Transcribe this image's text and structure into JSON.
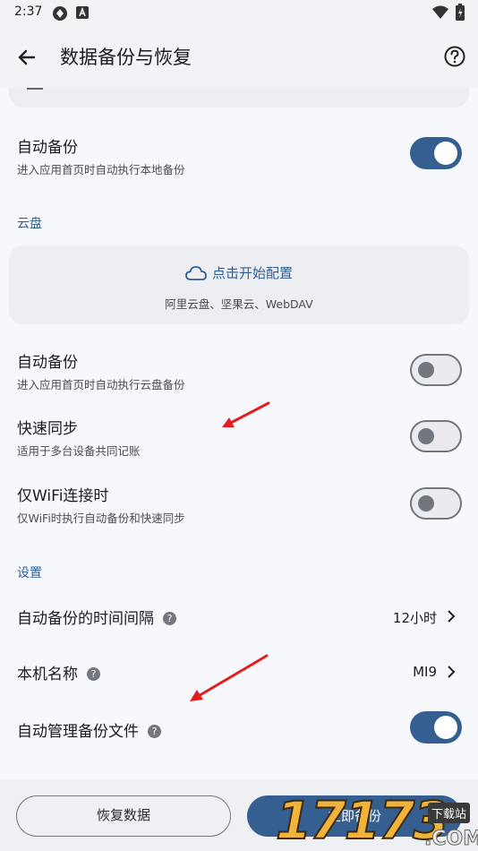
{
  "status_bar": {
    "time": "2:37"
  },
  "app_bar": {
    "title": "数据备份与恢复"
  },
  "local": {
    "auto_backup": {
      "title": "自动备份",
      "subtitle": "进入应用首页时自动执行本地备份",
      "enabled": true
    }
  },
  "cloud": {
    "section_label": "云盘",
    "config_label": "点击开始配置",
    "providers": "阿里云盘、坚果云、WebDAV",
    "auto_backup": {
      "title": "自动备份",
      "subtitle": "进入应用首页时自动执行云盘备份",
      "enabled": false
    },
    "fast_sync": {
      "title": "快速同步",
      "subtitle": "适用于多台设备共同记账",
      "enabled": false
    },
    "wifi_only": {
      "title": "仅WiFi连接时",
      "subtitle": "仅WiFi时执行自动备份和快速同步",
      "enabled": false
    }
  },
  "settings": {
    "section_label": "设置",
    "interval": {
      "title": "自动备份的时间间隔",
      "value": "12小时"
    },
    "device_name": {
      "title": "本机名称",
      "value": "MI9"
    },
    "auto_manage": {
      "title": "自动管理备份文件",
      "enabled": true
    }
  },
  "bottom": {
    "restore_label": "恢复数据",
    "backup_label": "立即备份"
  },
  "watermark": {
    "digits": "17173",
    "site": "下载站",
    "domain": ".COM"
  },
  "colors": {
    "accent": "#365f91",
    "section": "#2f5f93",
    "annotation_arrow": "#e02020"
  }
}
